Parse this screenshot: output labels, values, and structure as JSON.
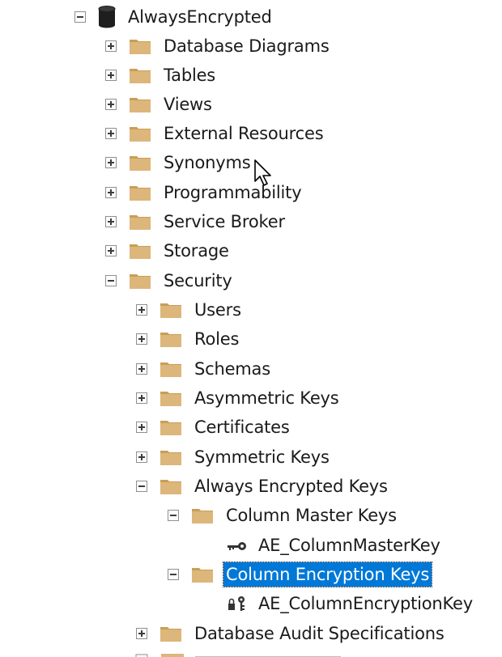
{
  "tree": {
    "root": {
      "label": "AlwaysEncrypted",
      "icon": "database-icon",
      "state": "expanded"
    },
    "db_children": [
      {
        "label": "Database Diagrams",
        "icon": "folder-icon",
        "state": "collapsed"
      },
      {
        "label": "Tables",
        "icon": "folder-icon",
        "state": "collapsed"
      },
      {
        "label": "Views",
        "icon": "folder-icon",
        "state": "collapsed"
      },
      {
        "label": "External Resources",
        "icon": "folder-icon",
        "state": "collapsed"
      },
      {
        "label": "Synonyms",
        "icon": "folder-icon",
        "state": "collapsed"
      },
      {
        "label": "Programmability",
        "icon": "folder-icon",
        "state": "collapsed"
      },
      {
        "label": "Service Broker",
        "icon": "folder-icon",
        "state": "collapsed"
      },
      {
        "label": "Storage",
        "icon": "folder-icon",
        "state": "collapsed"
      },
      {
        "label": "Security",
        "icon": "folder-icon",
        "state": "expanded"
      }
    ],
    "security_children": [
      {
        "label": "Users",
        "icon": "folder-icon",
        "state": "collapsed"
      },
      {
        "label": "Roles",
        "icon": "folder-icon",
        "state": "collapsed"
      },
      {
        "label": "Schemas",
        "icon": "folder-icon",
        "state": "collapsed"
      },
      {
        "label": "Asymmetric Keys",
        "icon": "folder-icon",
        "state": "collapsed"
      },
      {
        "label": "Certificates",
        "icon": "folder-icon",
        "state": "collapsed"
      },
      {
        "label": "Symmetric Keys",
        "icon": "folder-icon",
        "state": "collapsed"
      },
      {
        "label": "Always Encrypted Keys",
        "icon": "folder-icon",
        "state": "expanded"
      }
    ],
    "ae_children": [
      {
        "label": "Column Master Keys",
        "icon": "folder-icon",
        "state": "expanded"
      },
      {
        "label": "Column Encryption Keys",
        "icon": "folder-icon",
        "state": "expanded",
        "selected": true
      }
    ],
    "cmk_leaf": {
      "label": "AE_ColumnMasterKey",
      "icon": "key-icon"
    },
    "cek_leaf": {
      "label": "AE_ColumnEncryptionKey",
      "icon": "encryption-key-icon"
    },
    "after_ae": {
      "label": "Database Audit Specifications",
      "icon": "folder-icon",
      "state": "collapsed"
    }
  },
  "colors": {
    "folder": "#dcb67a",
    "folder_dark": "#c99e55",
    "selection": "#0078d7",
    "expander_border": "#8e8e8e"
  }
}
